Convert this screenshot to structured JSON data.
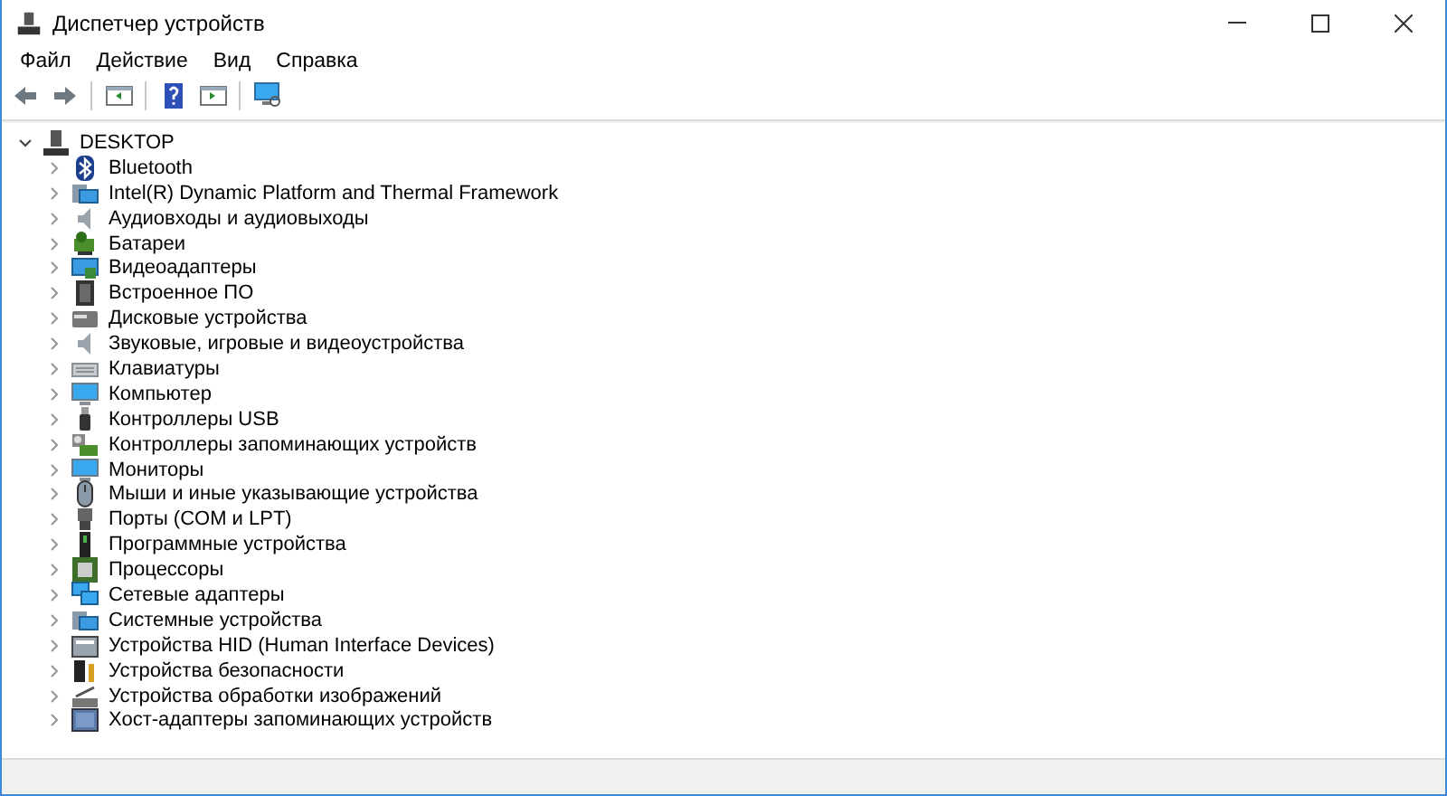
{
  "window": {
    "title": "Диспетчер устройств"
  },
  "menu": [
    "Файл",
    "Действие",
    "Вид",
    "Справка"
  ],
  "toolbar": [
    {
      "kind": "back",
      "disabled": false
    },
    {
      "kind": "forward",
      "disabled": false
    },
    {
      "kind": "separator"
    },
    {
      "kind": "tree"
    },
    {
      "kind": "separator"
    },
    {
      "kind": "help"
    },
    {
      "kind": "pane"
    },
    {
      "kind": "separator"
    },
    {
      "kind": "scan"
    }
  ],
  "tree": {
    "label": "DESKTOP",
    "expanded": true,
    "children": [
      {
        "label": "Bluetooth",
        "expanded": false
      },
      {
        "label": "Intel(R) Dynamic Platform and Thermal Framework",
        "expanded": false
      },
      {
        "label": "Аудиовходы и аудиовыходы",
        "expanded": false
      },
      {
        "label": "Батареи",
        "expanded": false
      },
      {
        "label": "Видеоадаптеры",
        "expanded": false
      },
      {
        "label": "Встроенное ПО",
        "expanded": false
      },
      {
        "label": "Дисковые устройства",
        "expanded": false
      },
      {
        "label": "Звуковые, игровые и видеоустройства",
        "expanded": false
      },
      {
        "label": "Клавиатуры",
        "expanded": false
      },
      {
        "label": "Компьютер",
        "expanded": false
      },
      {
        "label": "Контроллеры USB",
        "expanded": false
      },
      {
        "label": "Контроллеры запоминающих устройств",
        "expanded": false
      },
      {
        "label": "Мониторы",
        "expanded": false
      },
      {
        "label": "Мыши и иные указывающие устройства",
        "expanded": false
      },
      {
        "label": "Порты (COM и LPT)",
        "expanded": false
      },
      {
        "label": "Программные устройства",
        "expanded": false
      },
      {
        "label": "Процессоры",
        "expanded": false
      },
      {
        "label": "Сетевые адаптеры",
        "expanded": false
      },
      {
        "label": "Системные устройства",
        "expanded": false
      },
      {
        "label": "Устройства HID (Human Interface Devices)",
        "expanded": false
      },
      {
        "label": "Устройства безопасности",
        "expanded": false
      },
      {
        "label": "Устройства обработки изображений",
        "expanded": false
      },
      {
        "label": "Хост-адаптеры запоминающих устройств",
        "expanded": false
      }
    ]
  }
}
